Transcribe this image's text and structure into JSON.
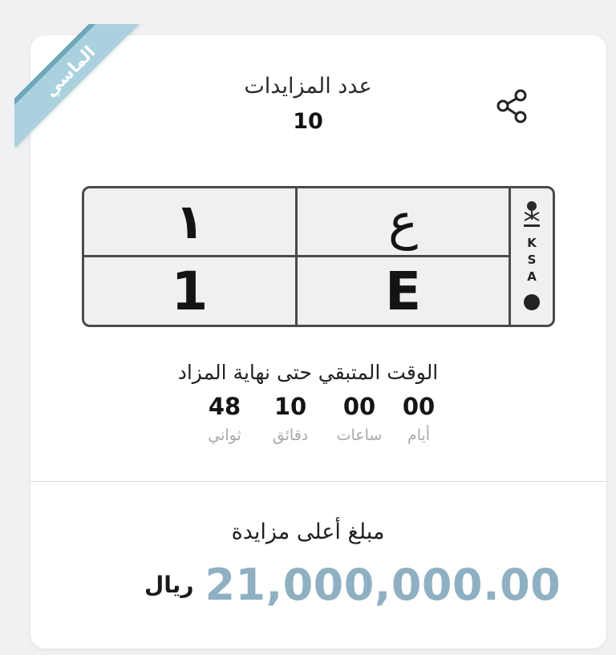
{
  "card": {
    "ribbon_label": "الماسي",
    "bids_title": "عدد المزايدات",
    "bids_count": "10"
  },
  "plate": {
    "arabic_number": "١",
    "arabic_letter": "ع",
    "english_number": "1",
    "english_letter": "E",
    "country_code": [
      "K",
      "S",
      "A"
    ]
  },
  "timer": {
    "title": "الوقت المتبقي حتى نهاية المزاد",
    "units": [
      {
        "value": "00",
        "label": "أيام"
      },
      {
        "value": "00",
        "label": "ساعات"
      },
      {
        "value": "10",
        "label": "دقائق"
      },
      {
        "value": "48",
        "label": "ثواني"
      }
    ]
  },
  "bid": {
    "title": "مبلغ أعلى مزايدة",
    "amount": "21,000,000.00",
    "currency": "ريال"
  },
  "icons": {
    "share": "share-icon",
    "emblem": "saudi-emblem-icon"
  },
  "colors": {
    "ribbon": "#a9d2de",
    "amount": "#8fb0c3",
    "muted_label": "#a8a8a8"
  }
}
